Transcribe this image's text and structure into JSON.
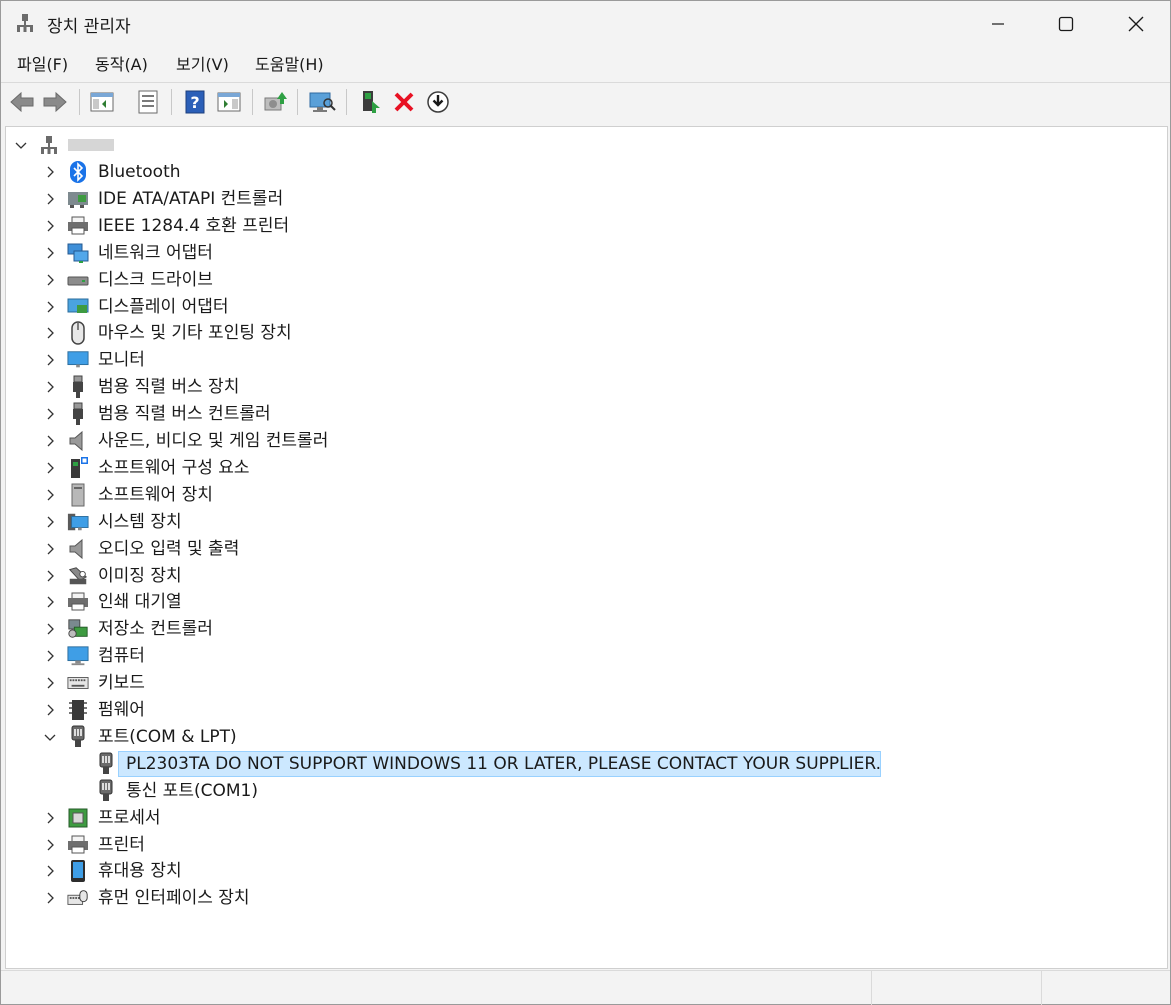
{
  "window": {
    "title": "장치 관리자"
  },
  "menu": {
    "items": [
      "파일(F)",
      "동작(A)",
      "보기(V)",
      "도움말(H)"
    ]
  },
  "toolbar": {
    "buttons": [
      "back-icon",
      "forward-icon",
      "show-hide-console-tree-icon",
      "properties-icon",
      "help-icon",
      "action-pane-icon",
      "update-driver-icon",
      "scan-hardware-icon",
      "enable-device-icon",
      "uninstall-device-icon",
      "download-icon"
    ]
  },
  "tree": {
    "root": {
      "label": "",
      "expanded": true
    },
    "categories": [
      {
        "label": "Bluetooth",
        "icon": "bluetooth-icon"
      },
      {
        "label": "IDE ATA/ATAPI 컨트롤러",
        "icon": "ide-controller-icon"
      },
      {
        "label": "IEEE 1284.4 호환 프린터",
        "icon": "printer-icon"
      },
      {
        "label": "네트워크 어댑터",
        "icon": "network-adapter-icon"
      },
      {
        "label": "디스크 드라이브",
        "icon": "disk-drive-icon"
      },
      {
        "label": "디스플레이 어댑터",
        "icon": "display-adapter-icon"
      },
      {
        "label": "마우스 및 기타 포인팅 장치",
        "icon": "mouse-icon"
      },
      {
        "label": "모니터",
        "icon": "monitor-icon"
      },
      {
        "label": "범용 직렬 버스 장치",
        "icon": "usb-device-icon"
      },
      {
        "label": "범용 직렬 버스 컨트롤러",
        "icon": "usb-controller-icon"
      },
      {
        "label": "사운드, 비디오 및 게임 컨트롤러",
        "icon": "speaker-icon"
      },
      {
        "label": "소프트웨어 구성 요소",
        "icon": "software-component-icon"
      },
      {
        "label": "소프트웨어 장치",
        "icon": "software-device-icon"
      },
      {
        "label": "시스템 장치",
        "icon": "system-device-icon"
      },
      {
        "label": "오디오 입력 및 출력",
        "icon": "audio-icon"
      },
      {
        "label": "이미징 장치",
        "icon": "camera-icon"
      },
      {
        "label": "인쇄 대기열",
        "icon": "print-queue-icon"
      },
      {
        "label": "저장소 컨트롤러",
        "icon": "storage-controller-icon"
      },
      {
        "label": "컴퓨터",
        "icon": "computer-icon"
      },
      {
        "label": "키보드",
        "icon": "keyboard-icon"
      },
      {
        "label": "펌웨어",
        "icon": "firmware-icon"
      },
      {
        "label": "포트(COM & LPT)",
        "icon": "port-icon",
        "expanded": true
      },
      {
        "label": "PL2303TA DO NOT SUPPORT WINDOWS 11 OR LATER, PLEASE CONTACT YOUR SUPPLIER.",
        "icon": "port-icon",
        "child": true,
        "selected": true
      },
      {
        "label": "통신 포트(COM1)",
        "icon": "port-icon",
        "child": true
      },
      {
        "label": "프로세서",
        "icon": "processor-icon"
      },
      {
        "label": "프린터",
        "icon": "printer-icon"
      },
      {
        "label": "휴대용 장치",
        "icon": "portable-device-icon"
      },
      {
        "label": "휴먼 인터페이스 장치",
        "icon": "hid-icon"
      }
    ]
  },
  "colors": {
    "selection_bg": "#cce8ff",
    "selection_border": "#99d1ff",
    "uninstall_red": "#e81123"
  }
}
